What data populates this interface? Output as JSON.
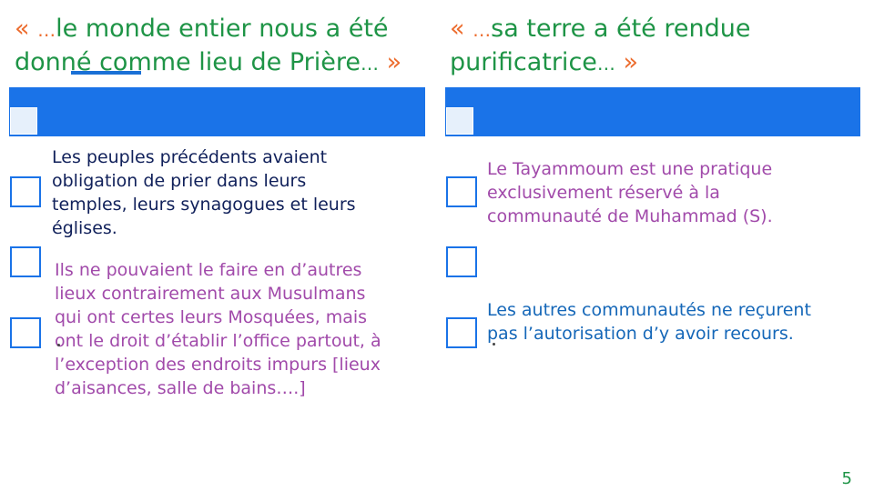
{
  "left": {
    "heading_open": "«",
    "heading_dots": "…",
    "heading_line1": "le monde entier nous a été",
    "heading_line2": "donné comme lieu de Prière",
    "heading_close_dots": "…",
    "heading_close": "»",
    "para1": [
      "Les peuples précédents avaient",
      "obligation de prier dans leurs",
      "temples, leurs synagogues et leurs",
      "églises."
    ],
    "para2": [
      "Ils ne pouvaient le faire en d’autres",
      "lieux contrairement aux Musulmans",
      "qui ont certes leurs Mosquées, mais",
      "ont le droit d’établir l’office partout, à",
      "l’exception des endroits impurs [lieux",
      "d’aisances, salle de bains….]"
    ]
  },
  "right": {
    "heading_open": "«",
    "heading_dots": "…",
    "heading_line1": "sa terre a été rendue",
    "heading_line2": "purificatrice",
    "heading_close_dots": "…",
    "heading_close": "»",
    "para1": [
      "Le Tayammoum est une pratique",
      "exclusivement réservé à la",
      "communauté de Muhammad (S)."
    ],
    "para2": [
      "Les autres communautés ne reçurent",
      "pas l’autorisation d’y avoir recours."
    ]
  },
  "page_number": "5",
  "colors": {
    "heading_green": "#1e9446",
    "quote_orange": "#ec6c2e",
    "band_blue": "#1a73e8",
    "text_navy": "#10205a",
    "text_violet": "#a14aaa",
    "text_blue": "#1567b8"
  }
}
